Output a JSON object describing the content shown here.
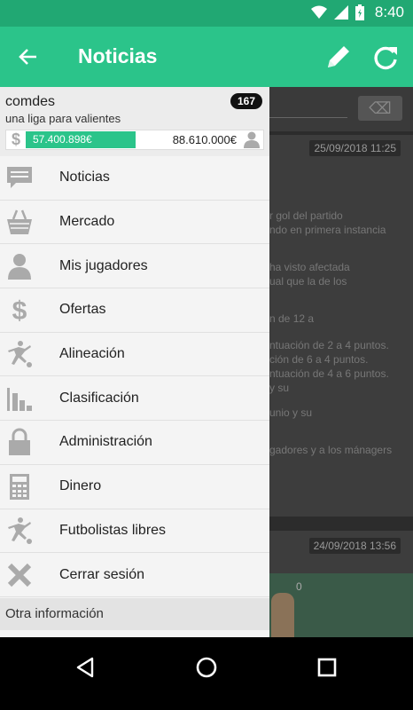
{
  "status_bar": {
    "time": "8:40",
    "icons": [
      "wifi-icon",
      "signal-icon",
      "battery-icon"
    ]
  },
  "app_bar": {
    "title": "Noticias",
    "back_icon": "arrow-back-icon",
    "actions": [
      "edit-icon",
      "refresh-icon"
    ],
    "color": "#2bc48a"
  },
  "drawer": {
    "league_name": "comdes",
    "league_subtitle": "una liga para valientes",
    "badge_count": "167",
    "money_available": "57.400.898€",
    "money_total": "88.610.000€",
    "menu": [
      {
        "label": "Noticias",
        "icon": "news-icon"
      },
      {
        "label": "Mercado",
        "icon": "basket-icon"
      },
      {
        "label": "Mis jugadores",
        "icon": "person-icon"
      },
      {
        "label": "Ofertas",
        "icon": "dollar-icon"
      },
      {
        "label": "Alineación",
        "icon": "kicker-icon"
      },
      {
        "label": "Clasificación",
        "icon": "bar-chart-icon"
      },
      {
        "label": "Administración",
        "icon": "lock-icon"
      },
      {
        "label": "Dinero",
        "icon": "calculator-icon"
      },
      {
        "label": "Futbolistas libres",
        "icon": "kicker-icon"
      },
      {
        "label": "Cerrar sesión",
        "icon": "close-icon"
      }
    ],
    "section_header": "Otra información"
  },
  "background": {
    "date_1": "25/09/2018 11:25",
    "date_2": "24/09/2018 13:56",
    "lines": [
      "r gol del partido",
      "ndo en primera instancia",
      "ha visto afectada",
      "ual que la de los",
      "n de 12 a",
      "ntuación de 2 a 4 puntos.",
      "ción de 6 a 4 puntos.",
      "ntuación de 4 a 6 puntos.",
      "y su",
      "unio y su",
      "gadores y a los mánagers"
    ],
    "player_number": "0"
  },
  "nav_bar": {
    "buttons": [
      "back-triangle-icon",
      "home-circle-icon",
      "recents-square-icon"
    ]
  }
}
